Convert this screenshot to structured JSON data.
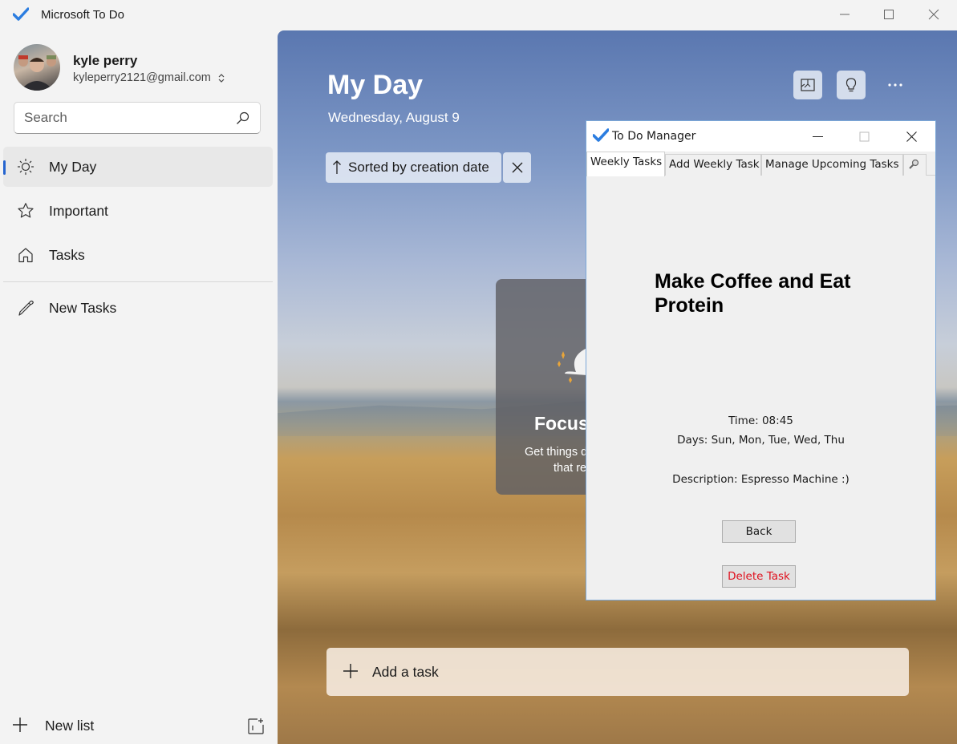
{
  "window": {
    "title": "Microsoft To Do",
    "accent": "#2564cf"
  },
  "user": {
    "name": "kyle perry",
    "email": "kyleperry2121@gmail.com"
  },
  "search": {
    "placeholder": "Search"
  },
  "sidebar": {
    "items": [
      {
        "label": "My Day",
        "icon": "sun-icon",
        "active": true
      },
      {
        "label": "Important",
        "icon": "star-icon"
      },
      {
        "label": "Tasks",
        "icon": "home-icon"
      },
      {
        "label": "New Tasks",
        "icon": "list-icon"
      }
    ],
    "new_list_label": "New list"
  },
  "main": {
    "title": "My Day",
    "date": "Wednesday, August 9",
    "sort_label": "Sorted by creation date",
    "focus_heading": "Focus",
    "focus_line1": "Get things d",
    "focus_line2": "that re",
    "add_task_label": "Add a task"
  },
  "dialog": {
    "title": "To Do Manager",
    "tabs": [
      "Weekly Tasks",
      "Add Weekly Task",
      "Manage Upcoming Tasks"
    ],
    "task_title": "Make Coffee and Eat Protein",
    "time_text": "Time: 08:45",
    "days_text": "Days: Sun, Mon, Tue, Wed, Thu",
    "description_text": "Description: Espresso Machine :)",
    "back_label": "Back",
    "delete_label": "Delete Task",
    "delete_color": "#e0101d"
  }
}
